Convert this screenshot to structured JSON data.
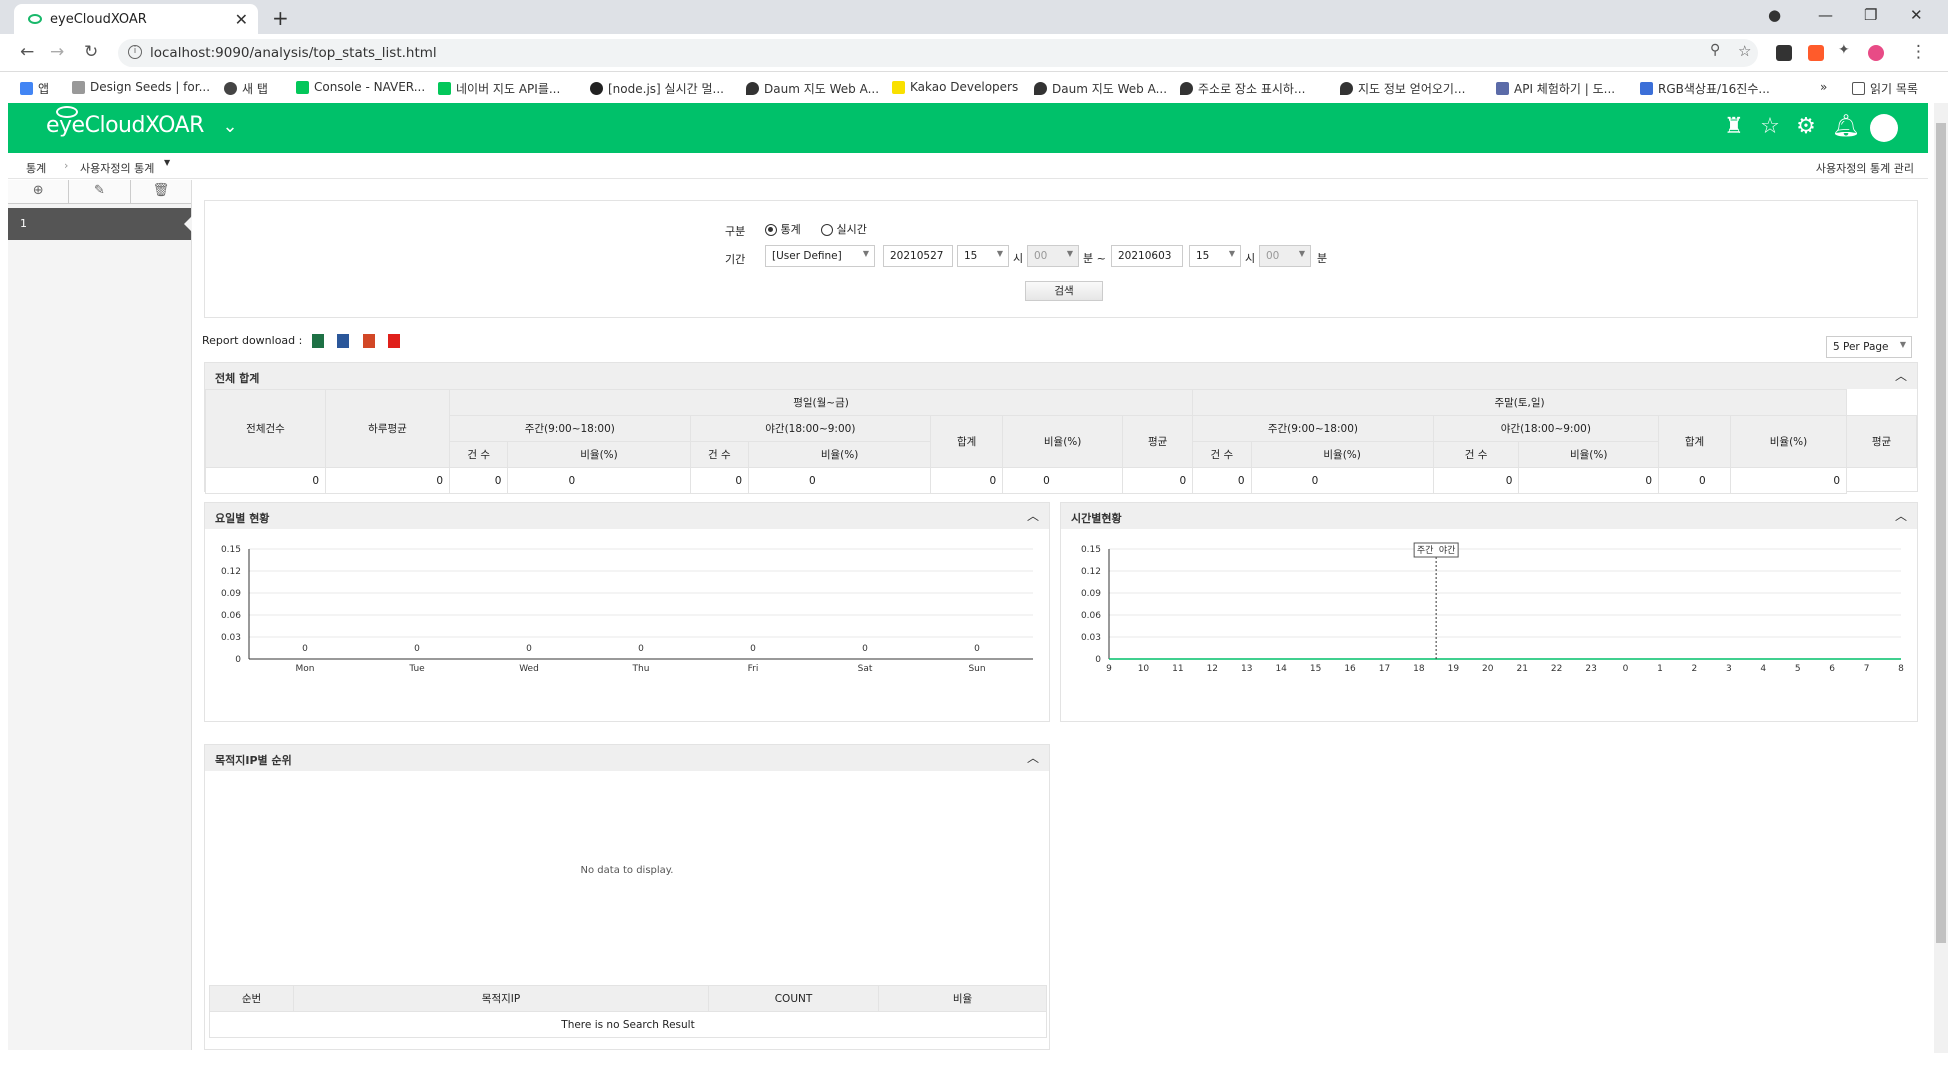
{
  "browser": {
    "tab_title": "eyeCloudXOAR",
    "url": "localhost:9090/analysis/top_stats_list.html",
    "bookmarks": [
      "앱",
      "Design Seeds | for...",
      "새 탭",
      "Console - NAVER...",
      "네이버 지도 API를...",
      "[node.js] 실시간 멀...",
      "Daum 지도 Web A...",
      "Kakao Developers",
      "Daum 지도 Web A...",
      "주소로 장소 표시하...",
      "지도 정보 얻어오기...",
      "API 체험하기 | 도...",
      "RGB색상표/16진수..."
    ],
    "reading_list": "읽기 목록",
    "more": "»"
  },
  "app": {
    "logo": "eyeCloudXOAR",
    "brand_color": "#00c16a"
  },
  "breadcrumb": {
    "root": "통계",
    "current": "사용자정의 통계",
    "right": "사용자정의 통계 관리"
  },
  "sidebar": {
    "item": "1"
  },
  "search": {
    "type_label": "구분",
    "opt_stats": "통계",
    "opt_realtime": "실시간",
    "period_label": "기간",
    "range": "[User Define]",
    "from_date": "20210527",
    "from_hour": "15",
    "hour_unit": "시",
    "from_min": "00",
    "min_tilde": "분 ~",
    "to_date": "20210603",
    "to_hour": "15",
    "to_min": "00",
    "min_unit": "분",
    "button": "검색"
  },
  "report": {
    "label": "Report download :",
    "per_page": "5 Per Page"
  },
  "totals": {
    "title": "전체 합계",
    "h_total": "전체건수",
    "h_daily": "하루평균",
    "h_weekday": "평일(월~금)",
    "h_weekend": "주말(토,일)",
    "h_day": "주간(9:00~18:00)",
    "h_night": "야간(18:00~9:00)",
    "h_count": "건 수",
    "h_ratio": "비율(%)",
    "h_sum": "합계",
    "h_avg": "평균",
    "values": [
      "0",
      "0",
      "0",
      "0",
      "0",
      "0",
      "0",
      "0",
      "0",
      "0",
      "0",
      "0",
      "0",
      "0",
      "0"
    ]
  },
  "weekday_chart": {
    "title": "요일별 현황",
    "chart_data": {
      "type": "bar",
      "categories": [
        "Mon",
        "Tue",
        "Wed",
        "Thu",
        "Fri",
        "Sat",
        "Sun"
      ],
      "values": [
        0,
        0,
        0,
        0,
        0,
        0,
        0
      ],
      "yticks": [
        "0.15",
        "0.12",
        "0.09",
        "0.06",
        "0.03",
        "0"
      ],
      "ylim": [
        0,
        0.15
      ]
    }
  },
  "hourly_chart": {
    "title": "시간별현황",
    "legend_day": "주간",
    "legend_night": "야간",
    "chart_data": {
      "type": "line",
      "x": [
        "9",
        "10",
        "11",
        "12",
        "13",
        "14",
        "15",
        "16",
        "17",
        "18",
        "19",
        "20",
        "21",
        "22",
        "23",
        "0",
        "1",
        "2",
        "3",
        "4",
        "5",
        "6",
        "7",
        "8"
      ],
      "values": [
        0,
        0,
        0,
        0,
        0,
        0,
        0,
        0,
        0,
        0,
        0,
        0,
        0,
        0,
        0,
        0,
        0,
        0,
        0,
        0,
        0,
        0,
        0,
        0
      ],
      "yticks": [
        "0.15",
        "0.12",
        "0.09",
        "0.06",
        "0.03",
        "0"
      ],
      "ylim": [
        0,
        0.15
      ]
    }
  },
  "dest_ip": {
    "title": "목적지IP별 순위",
    "empty_chart": "No data to display.",
    "cols": [
      "순번",
      "목적지IP",
      "COUNT",
      "비율"
    ],
    "empty_table": "There is no Search Result"
  }
}
